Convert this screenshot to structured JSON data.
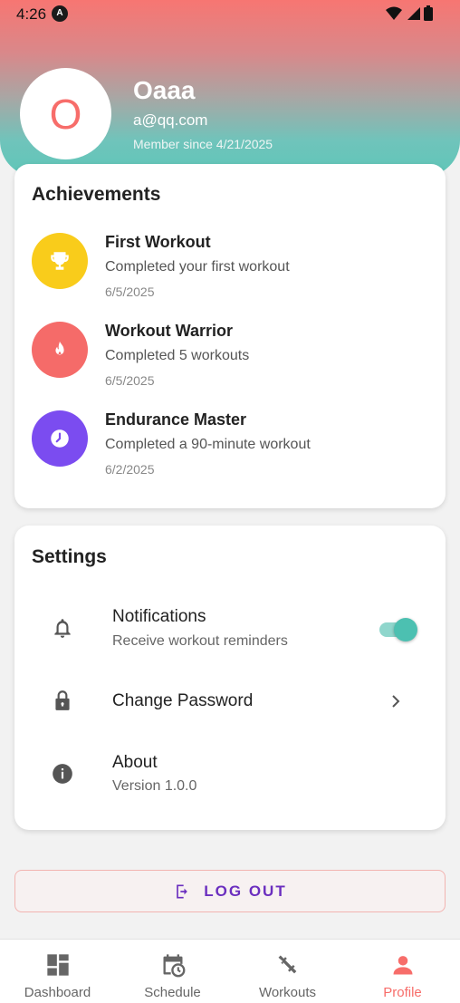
{
  "status_bar": {
    "time": "4:26",
    "app_icon_letter": "A"
  },
  "profile": {
    "avatar_initial": "O",
    "name": "Oaaa",
    "email": "a@qq.com",
    "member_since": "Member since 4/21/2025"
  },
  "achievements": {
    "title": "Achievements",
    "items": [
      {
        "title": "First Workout",
        "description": "Completed your first workout",
        "date": "6/5/2025",
        "icon": "trophy-icon",
        "color": "#f9cc1b"
      },
      {
        "title": "Workout Warrior",
        "description": "Completed 5 workouts",
        "date": "6/5/2025",
        "icon": "flame-icon",
        "color": "#f56b69"
      },
      {
        "title": "Endurance Master",
        "description": "Completed a 90-minute workout",
        "date": "6/2/2025",
        "icon": "clock-icon",
        "color": "#7b4cf0"
      }
    ]
  },
  "settings": {
    "title": "Settings",
    "notifications": {
      "label": "Notifications",
      "sublabel": "Receive workout reminders",
      "enabled": true,
      "icon": "bell-icon"
    },
    "change_password": {
      "label": "Change Password",
      "icon": "lock-icon"
    },
    "about": {
      "label": "About",
      "sublabel": "Version 1.0.0",
      "icon": "info-icon"
    }
  },
  "logout": {
    "label": "LOG OUT",
    "icon": "logout-icon"
  },
  "bottom_nav": {
    "items": [
      {
        "label": "Dashboard",
        "icon": "dashboard-icon"
      },
      {
        "label": "Schedule",
        "icon": "calendar-clock-icon"
      },
      {
        "label": "Workouts",
        "icon": "dumbbell-icon"
      },
      {
        "label": "Profile",
        "icon": "person-icon"
      }
    ],
    "active": "Profile"
  },
  "colors": {
    "accent": "#f76d6a",
    "teal": "#4cc0b1",
    "purple": "#6b2fbf"
  }
}
